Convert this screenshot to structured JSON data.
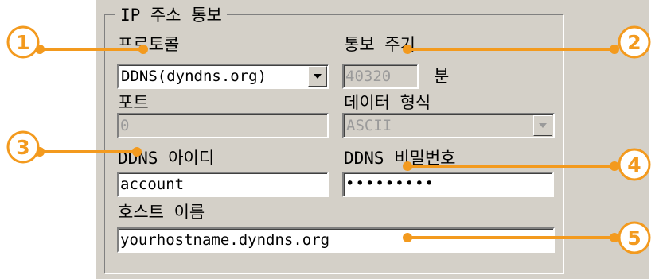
{
  "group": {
    "title": "IP 주소 통보"
  },
  "protocol": {
    "label": "프로토콜",
    "value": "DDNS(dyndns.org)"
  },
  "interval": {
    "label": "통보 주기",
    "value": "40320",
    "unit": "분"
  },
  "port": {
    "label": "포트",
    "value": "0"
  },
  "data_format": {
    "label": "데이터 형식",
    "value": "ASCII"
  },
  "ddns_id": {
    "label": "DDNS 아이디",
    "value": "account"
  },
  "ddns_password": {
    "label": "DDNS 비밀번호",
    "value": "•••••••••"
  },
  "hostname": {
    "label": "호스트 이름",
    "value": "yourhostname.dyndns.org"
  },
  "callouts": [
    "1",
    "2",
    "3",
    "4",
    "5"
  ],
  "colors": {
    "accent": "#f39a1e",
    "dialog_bg": "#d4d0c8"
  }
}
